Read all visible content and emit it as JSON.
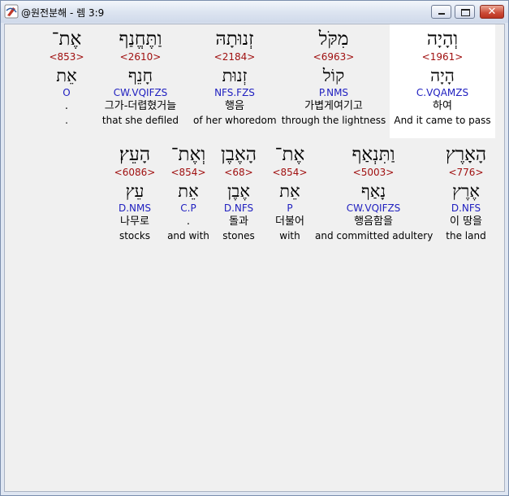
{
  "window": {
    "title": "@원전분해 - 렘 3:9",
    "close_glyph": "✕"
  },
  "rows": [
    [
      {
        "hebrew": "וְהָיָה",
        "strong": "<1961>",
        "lemma": "הָיָה",
        "morph": "C.VQAMZS",
        "korean": "하여",
        "english": "And it came to pass",
        "highlight": true
      },
      {
        "hebrew": "מִקֹּל",
        "strong": "<6963>",
        "lemma": "קוֹל",
        "morph": "P.NMS",
        "korean": "가볍게여기고",
        "english": "through the lightness"
      },
      {
        "hebrew": "זְנוּתָהּ",
        "strong": "<2184>",
        "lemma": "זְנוּת",
        "morph": "NFS.FZS",
        "korean": "행음",
        "english": "of her whoredom"
      },
      {
        "hebrew": "וַתֶּחֱנַף",
        "strong": "<2610>",
        "lemma": "חָנֵף",
        "morph": "CW.VQIFZS",
        "korean": "그가-더렵혔거늘",
        "english": "that she defiled"
      },
      {
        "hebrew": "אֶת־",
        "strong": "<853>",
        "lemma": "אֵת",
        "morph": "O",
        "korean": ".",
        "english": "."
      }
    ],
    [
      {
        "hebrew": "הָאָרֶץ",
        "strong": "<776>",
        "lemma": "אֶרֶץ",
        "morph": "D.NFS",
        "korean": "이 땅을",
        "english": "the land"
      },
      {
        "hebrew": "וַתִּנְאַף",
        "strong": "<5003>",
        "lemma": "נָאַף",
        "morph": "CW.VQIFZS",
        "korean": "행음함을",
        "english": "and committed adultery"
      },
      {
        "hebrew": "אֶת־",
        "strong": "<854>",
        "lemma": "אֵת",
        "morph": "P",
        "korean": "더불어",
        "english": "with"
      },
      {
        "hebrew": "הָאֶבֶן",
        "strong": "<68>",
        "lemma": "אֶבֶן",
        "morph": "D.NFS",
        "korean": "돌과",
        "english": "stones"
      },
      {
        "hebrew": "וְאֶת־",
        "strong": "<854>",
        "lemma": "אֵת",
        "morph": "C.P",
        "korean": ".",
        "english": "and with"
      },
      {
        "hebrew": "הָעֵץ׃",
        "strong": "<6086>",
        "lemma": "עֵץ",
        "morph": "D.NMS",
        "korean": "나무로",
        "english": "stocks"
      }
    ]
  ]
}
